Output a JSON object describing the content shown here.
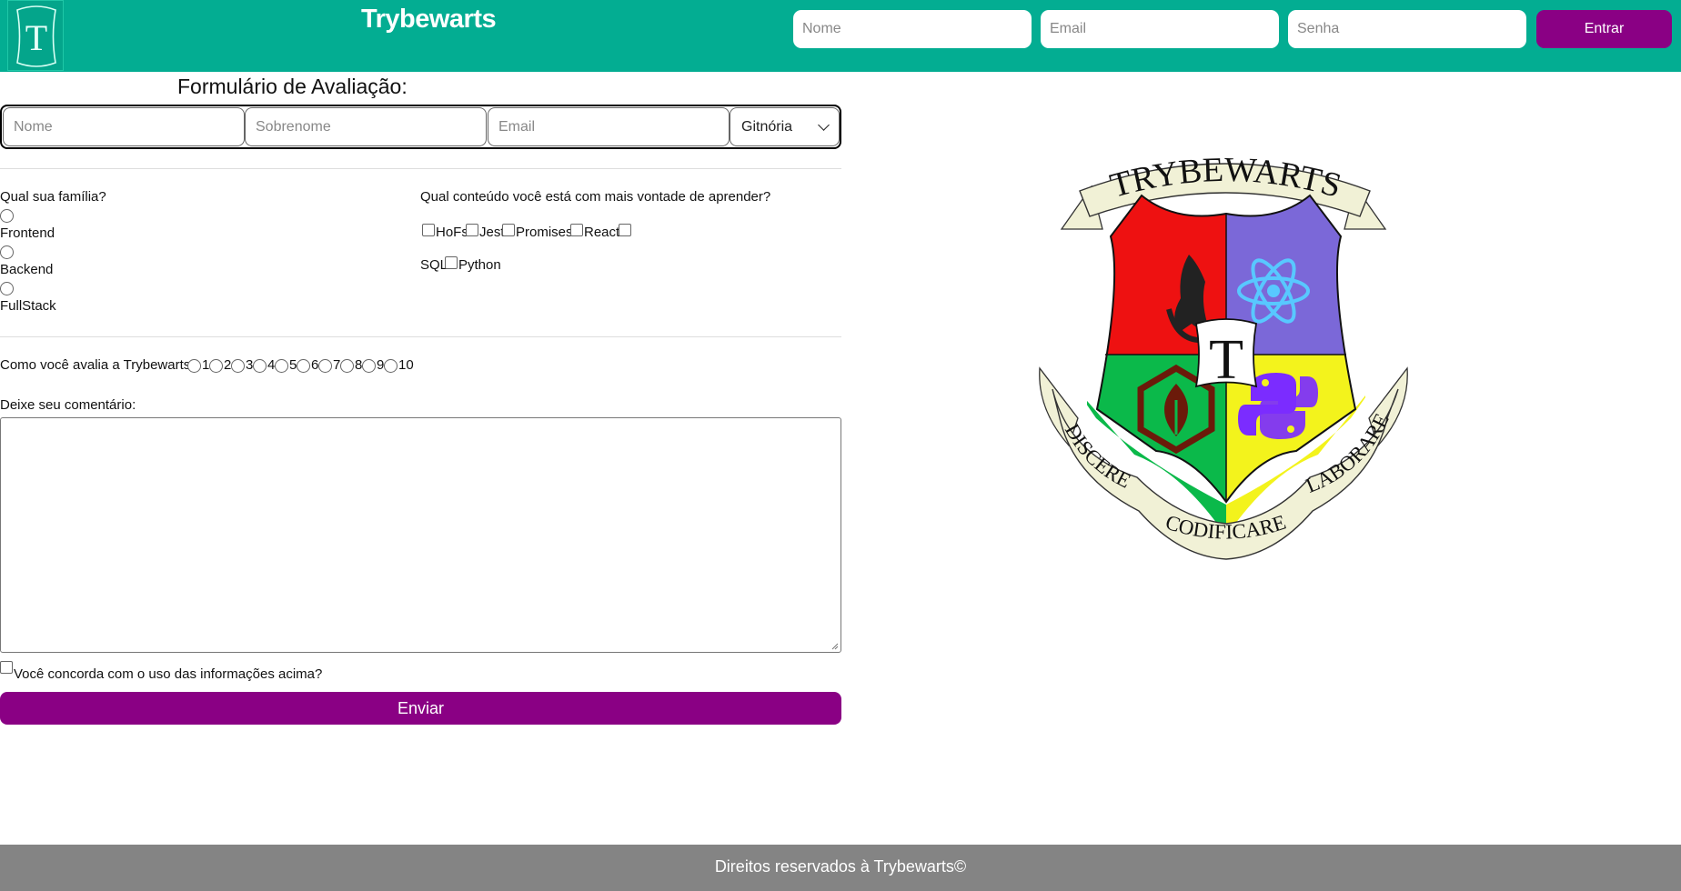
{
  "header": {
    "logo_letter": "T",
    "title": "Trybewarts",
    "login": {
      "name_placeholder": "Nome",
      "email_placeholder": "Email",
      "password_placeholder": "Senha",
      "submit_label": "Entrar"
    }
  },
  "form": {
    "title": "Formulário de Avaliação:",
    "name_placeholder": "Nome",
    "lastname_placeholder": "Sobrenome",
    "email_placeholder": "Email",
    "house_selected": "Gitnória",
    "family_question": "Qual sua família?",
    "families": [
      "Frontend",
      "Backend",
      "FullStack"
    ],
    "content_question": "Qual conteúdo você está com mais vontade de aprender?",
    "contents": [
      "HoFs",
      "Jest",
      "Promises",
      "React",
      "SQL",
      "Python"
    ],
    "rating_question": "Como você avalia a Trybewarts?",
    "ratings": [
      "1",
      "2",
      "3",
      "4",
      "5",
      "6",
      "7",
      "8",
      "9",
      "10"
    ],
    "comment_label": "Deixe seu comentário:",
    "agreement_label": "Você concorda com o uso das informações acima?",
    "submit_label": "Enviar"
  },
  "crest": {
    "banner_top": "TRYBEWARTS",
    "center_letter": "T",
    "motto_left": "DISCERE",
    "motto_center": "CODIFICARE",
    "motto_right": "LABORARE",
    "colors": {
      "red": "#ee1111",
      "purple": "#7b68d8",
      "green": "#0bb94a",
      "yellow": "#f3f31c",
      "scroll": "#f1f1d6"
    }
  },
  "footer": {
    "text": "Direitos reservados à Trybewarts©"
  },
  "colors": {
    "header_bg": "#03ad92",
    "accent_purple": "#8a0084",
    "footer_bg": "#848484"
  }
}
